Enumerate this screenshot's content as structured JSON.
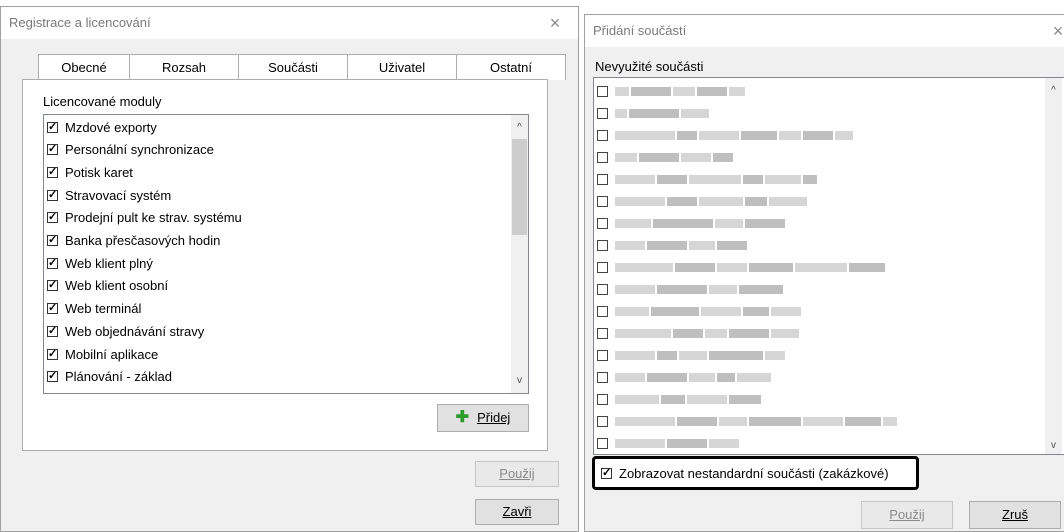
{
  "left_window": {
    "title": "Registrace a licencování",
    "tabs": [
      "Obecné",
      "Rozsah",
      "Součásti",
      "Uživatel",
      "Ostatní"
    ],
    "active_tab": "Součásti",
    "list_label": "Licencované moduly",
    "modules": [
      "Mzdové exporty",
      "Personální synchronizace",
      "Potisk karet",
      "Stravovací systém",
      "Prodejní pult ke strav. systému",
      "Banka přesčasových hodin",
      "Web klient plný",
      "Web klient osobní",
      "Web terminál",
      "Web objednávání stravy",
      "Mobilní aplikace",
      "Plánování - základ"
    ],
    "add_button": "Přidej",
    "apply_button": "Použij",
    "close_button": "Zavři",
    "scroll_up": "^",
    "scroll_down": "v"
  },
  "right_window": {
    "title": "Přidání součástí",
    "list_label": "Nevyužité součásti",
    "item_count": 17,
    "show_nonstandard": "Zobrazovat nestandardní součásti (zakázkové)",
    "apply_button": "Použij",
    "cancel_button": "Zruš",
    "scroll_up": "^",
    "scroll_down": "v"
  },
  "close_glyph": "×"
}
